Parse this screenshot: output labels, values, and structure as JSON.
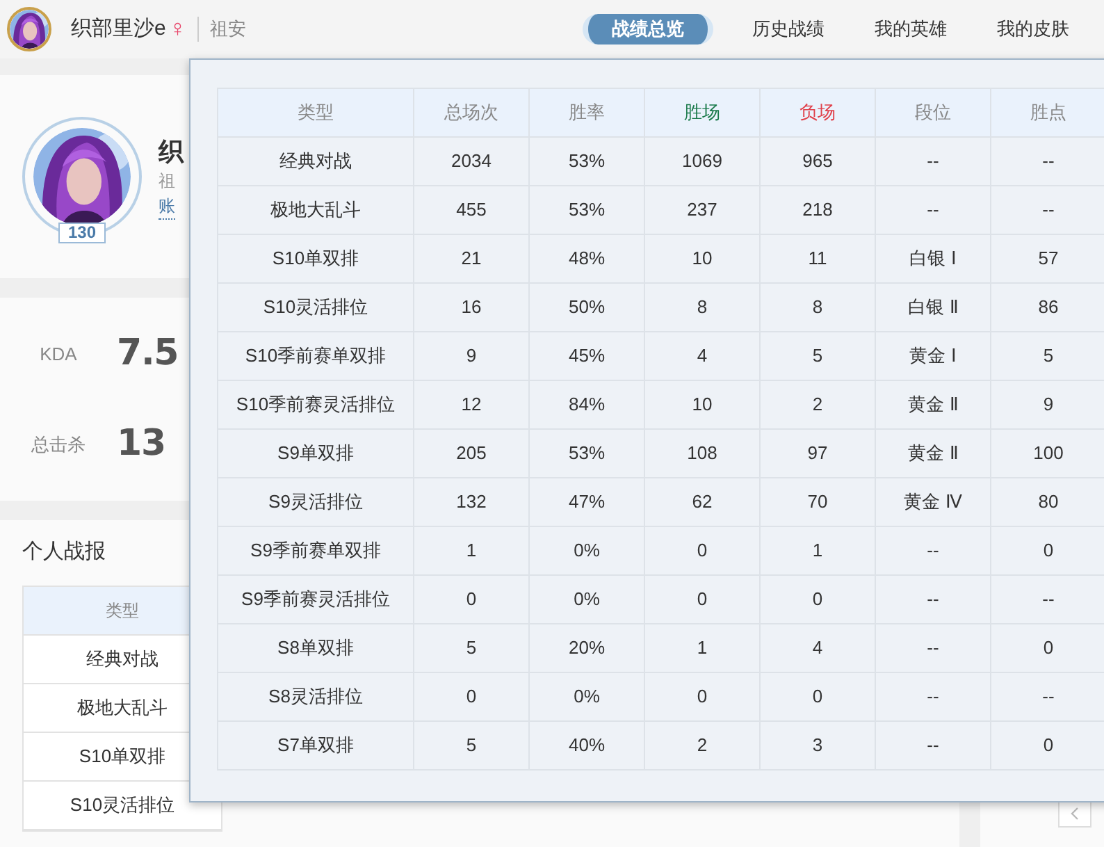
{
  "header": {
    "name": "织部里沙e",
    "gender": "♀",
    "server": "祖安",
    "tabs": [
      {
        "label": "战绩总览",
        "selected": true
      },
      {
        "label": "历史战绩",
        "selected": false
      },
      {
        "label": "我的英雄",
        "selected": false
      },
      {
        "label": "我的皮肤",
        "selected": false
      }
    ]
  },
  "profile": {
    "level": "130",
    "name_partial": "织",
    "server_partial": "祖",
    "account_partial": "账"
  },
  "stats": [
    {
      "label": "KDA",
      "value": "7.5"
    },
    {
      "label": "总击杀",
      "value": "13"
    }
  ],
  "report": {
    "title": "个人战报",
    "column": "类型",
    "rows": [
      "经典对战",
      "极地大乱斗",
      "S10单双排",
      "S10灵活排位"
    ]
  },
  "popup": {
    "columns": [
      {
        "label": "类型",
        "color": "#888888"
      },
      {
        "label": "总场次",
        "color": "#888888"
      },
      {
        "label": "胜率",
        "color": "#888888"
      },
      {
        "label": "胜场",
        "color": "#1a7a4a"
      },
      {
        "label": "负场",
        "color": "#e0404a"
      },
      {
        "label": "段位",
        "color": "#888888"
      },
      {
        "label": "胜点",
        "color": "#888888"
      }
    ],
    "rows": [
      [
        "经典对战",
        "2034",
        "53%",
        "1069",
        "965",
        "--",
        "--"
      ],
      [
        "极地大乱斗",
        "455",
        "53%",
        "237",
        "218",
        "--",
        "--"
      ],
      [
        "S10单双排",
        "21",
        "48%",
        "10",
        "11",
        "白银 Ⅰ",
        "57"
      ],
      [
        "S10灵活排位",
        "16",
        "50%",
        "8",
        "8",
        "白银 Ⅱ",
        "86"
      ],
      [
        "S10季前赛单双排",
        "9",
        "45%",
        "4",
        "5",
        "黄金 Ⅰ",
        "5"
      ],
      [
        "S10季前赛灵活排位",
        "12",
        "84%",
        "10",
        "2",
        "黄金 Ⅱ",
        "9"
      ],
      [
        "S9单双排",
        "205",
        "53%",
        "108",
        "97",
        "黄金 Ⅱ",
        "100"
      ],
      [
        "S9灵活排位",
        "132",
        "47%",
        "62",
        "70",
        "黄金 Ⅳ",
        "80"
      ],
      [
        "S9季前赛单双排",
        "1",
        "0%",
        "0",
        "1",
        "--",
        "0"
      ],
      [
        "S9季前赛灵活排位",
        "0",
        "0%",
        "0",
        "0",
        "--",
        "--"
      ],
      [
        "S8单双排",
        "5",
        "20%",
        "1",
        "4",
        "--",
        "0"
      ],
      [
        "S8灵活排位",
        "0",
        "0%",
        "0",
        "0",
        "--",
        "--"
      ],
      [
        "S7单双排",
        "5",
        "40%",
        "2",
        "3",
        "--",
        "0"
      ]
    ]
  }
}
